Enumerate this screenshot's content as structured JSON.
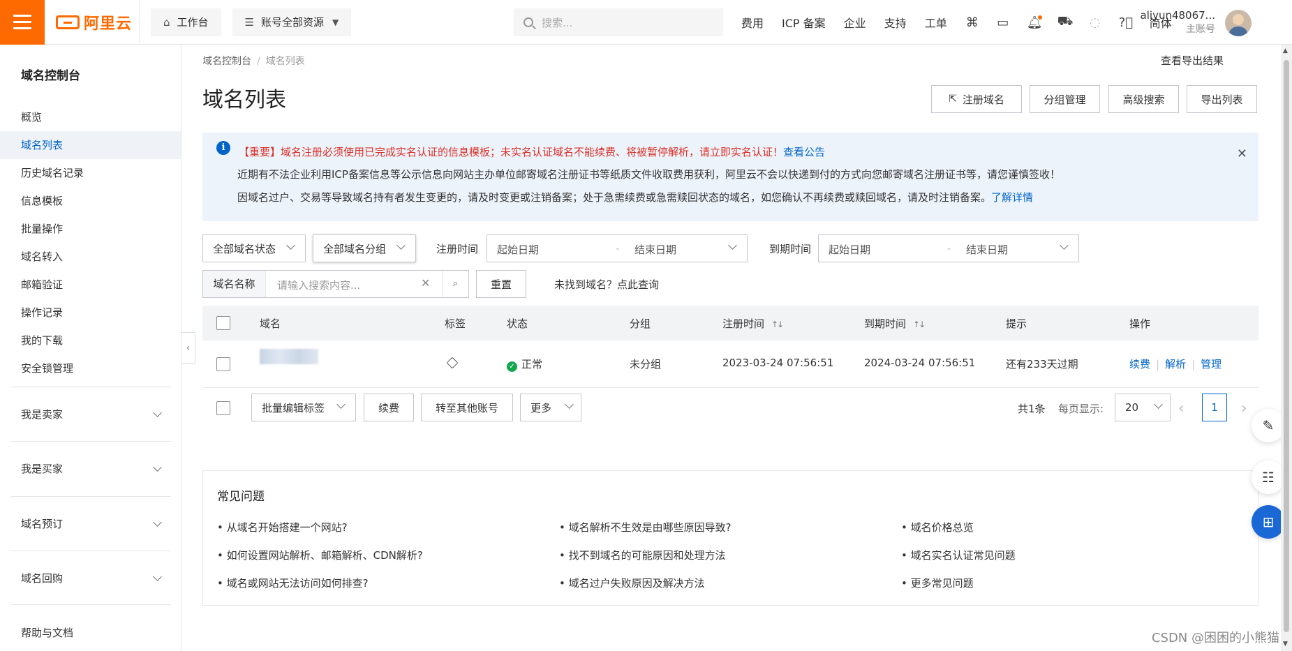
{
  "topbar": {
    "logo_text": "阿里云",
    "workbench": "工作台",
    "resources": "账号全部资源",
    "search_placeholder": "搜索...",
    "links": [
      "费用",
      "ICP 备案",
      "企业",
      "支持",
      "工单"
    ],
    "lang": "简体",
    "user_name": "aliyun48067...",
    "user_role": "主账号",
    "brand_color": "#ff6a00"
  },
  "sidebar": {
    "title": "域名控制台",
    "items": [
      "概览",
      "域名列表",
      "历史域名记录",
      "信息模板",
      "批量操作",
      "域名转入",
      "邮箱验证",
      "操作记录",
      "我的下载",
      "安全锁管理"
    ],
    "groups": [
      "我是卖家",
      "我是买家",
      "域名预订",
      "域名回购"
    ],
    "help": "帮助与文档"
  },
  "breadcrumb": {
    "root": "域名控制台",
    "current": "域名列表"
  },
  "export_result": "查看导出结果",
  "page_title": "域名列表",
  "header_buttons": {
    "register": "注册域名",
    "group_manage": "分组管理",
    "advanced_search": "高级搜索",
    "export_list": "导出列表"
  },
  "notice": {
    "line1_prefix": "【重要】",
    "line1_text": "域名注册必须使用已完成实名认证的信息模板；未实名认证域名不能续费、将被暂停解析，请立即实名认证！",
    "line1_link": "查看公告",
    "line2": "近期有不法企业利用ICP备案信息等公示信息向网站主办单位邮寄域名注册证书等纸质文件收取费用获利，阿里云不会以快递到付的方式向您邮寄域名注册证书等，请您谨慎签收！",
    "line3": "因域名过户、交易等导致域名持有者发生变更的，请及时变更或注销备案；处于急需续费或急需赎回状态的域名，如您确认不再续费或赎回域名，请及时注销备案。",
    "line3_link": "了解详情"
  },
  "filters": {
    "status": "全部域名状态",
    "group": "全部域名分组",
    "reg_time_label": "注册时间",
    "exp_time_label": "到期时间",
    "start_date": "起始日期",
    "end_date": "结束日期",
    "range_sep": "-",
    "name_label": "域名名称",
    "search_placeholder": "请输入搜索内容...",
    "reset": "重置",
    "not_found_link": "未找到域名？点此查询"
  },
  "table": {
    "columns": [
      "域名",
      "标签",
      "状态",
      "分组",
      "注册时间",
      "到期时间",
      "提示",
      "操作"
    ],
    "rows": [
      {
        "status": "正常",
        "group": "未分组",
        "reg_time": "2023-03-24 07:56:51",
        "exp_time": "2024-03-24 07:56:51",
        "hint": "还有233天过期",
        "ops": [
          "续费",
          "解析",
          "管理"
        ]
      }
    ]
  },
  "bulk": {
    "edit_tags": "批量编辑标签",
    "renew": "续费",
    "transfer": "转至其他账号",
    "more": "更多"
  },
  "pagination": {
    "total": "共1条",
    "per_page_label": "每页显示:",
    "per_page": "20",
    "current_page": "1"
  },
  "faq": {
    "title": "常见问题",
    "items": [
      "• 从域名开始搭建一个网站?",
      "• 域名解析不生效是由哪些原因导致?",
      "• 域名价格总览",
      "• 如何设置网站解析、邮箱解析、CDN解析?",
      "• 找不到域名的可能原因和处理方法",
      "• 域名实名认证常见问题",
      "• 域名或网站无法访问如何排查?",
      "• 域名过户失败原因及解决方法",
      "• 更多常见问题"
    ]
  },
  "watermark": "CSDN @困困的小熊猫"
}
